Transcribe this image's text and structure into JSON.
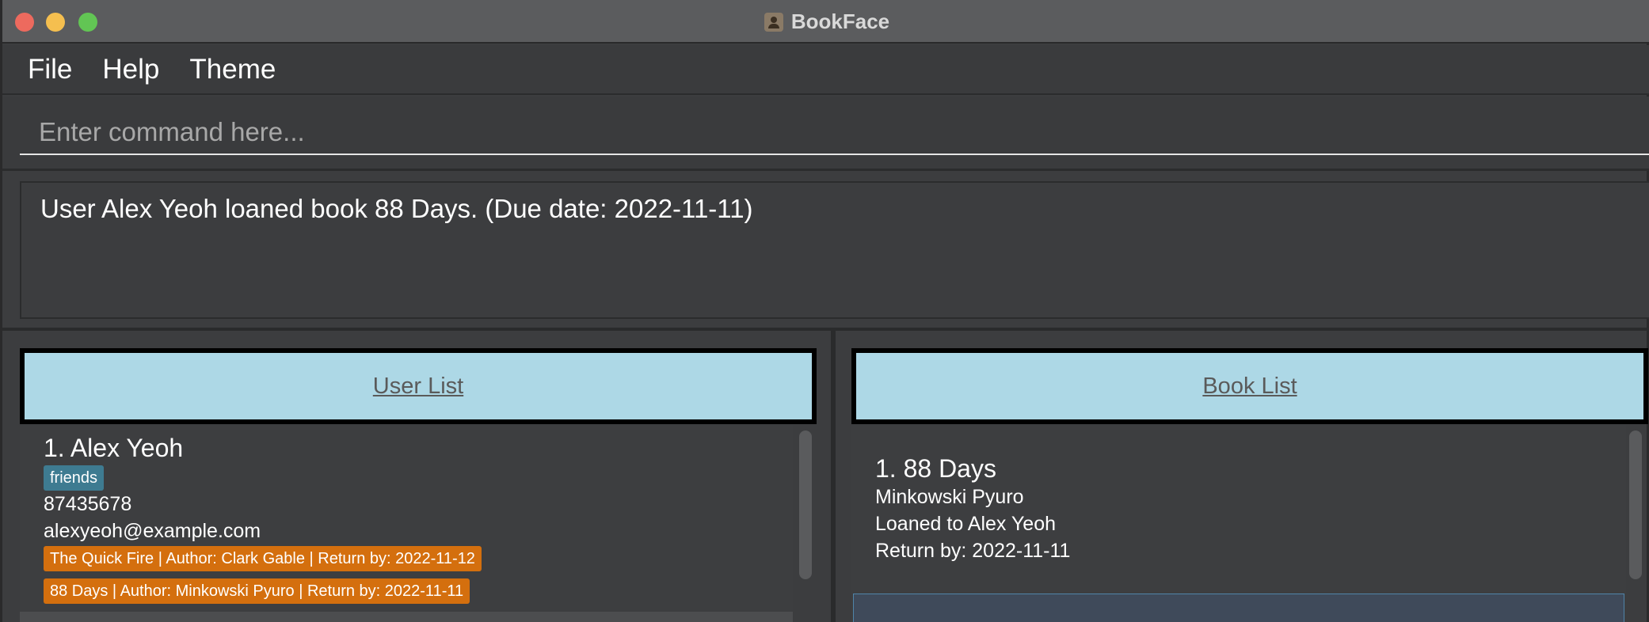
{
  "window": {
    "title": "BookFace"
  },
  "menu": {
    "items": [
      "File",
      "Help",
      "Theme"
    ]
  },
  "command": {
    "placeholder": "Enter command here...",
    "value": ""
  },
  "result": {
    "message": "User Alex Yeoh loaned book 88 Days. (Due date: 2022-11-11)"
  },
  "user_list": {
    "header": "User List",
    "users": [
      {
        "index": "1.",
        "name": "Alex Yeoh",
        "name_line": "1.  Alex Yeoh",
        "tags": [
          "friends"
        ],
        "phone": "87435678",
        "email": "alexyeoh@example.com",
        "loans": [
          "The Quick Fire | Author: Clark Gable | Return by: 2022-11-12",
          "88 Days | Author: Minkowski Pyuro | Return by: 2022-11-11"
        ]
      }
    ]
  },
  "book_list": {
    "header": "Book List",
    "books": [
      {
        "title_line": "1.  88 Days",
        "author": "Minkowski Pyuro",
        "loaned_to": "Loaned to Alex Yeoh",
        "return_by": "Return by: 2022-11-11"
      }
    ]
  },
  "colors": {
    "header_bg": "#add8e6",
    "tag_friends": "#3e7b91",
    "loan_tag": "#d46f0e",
    "window_bg": "#3c3d3f"
  },
  "icons": {
    "app": "bookface-app-icon"
  }
}
